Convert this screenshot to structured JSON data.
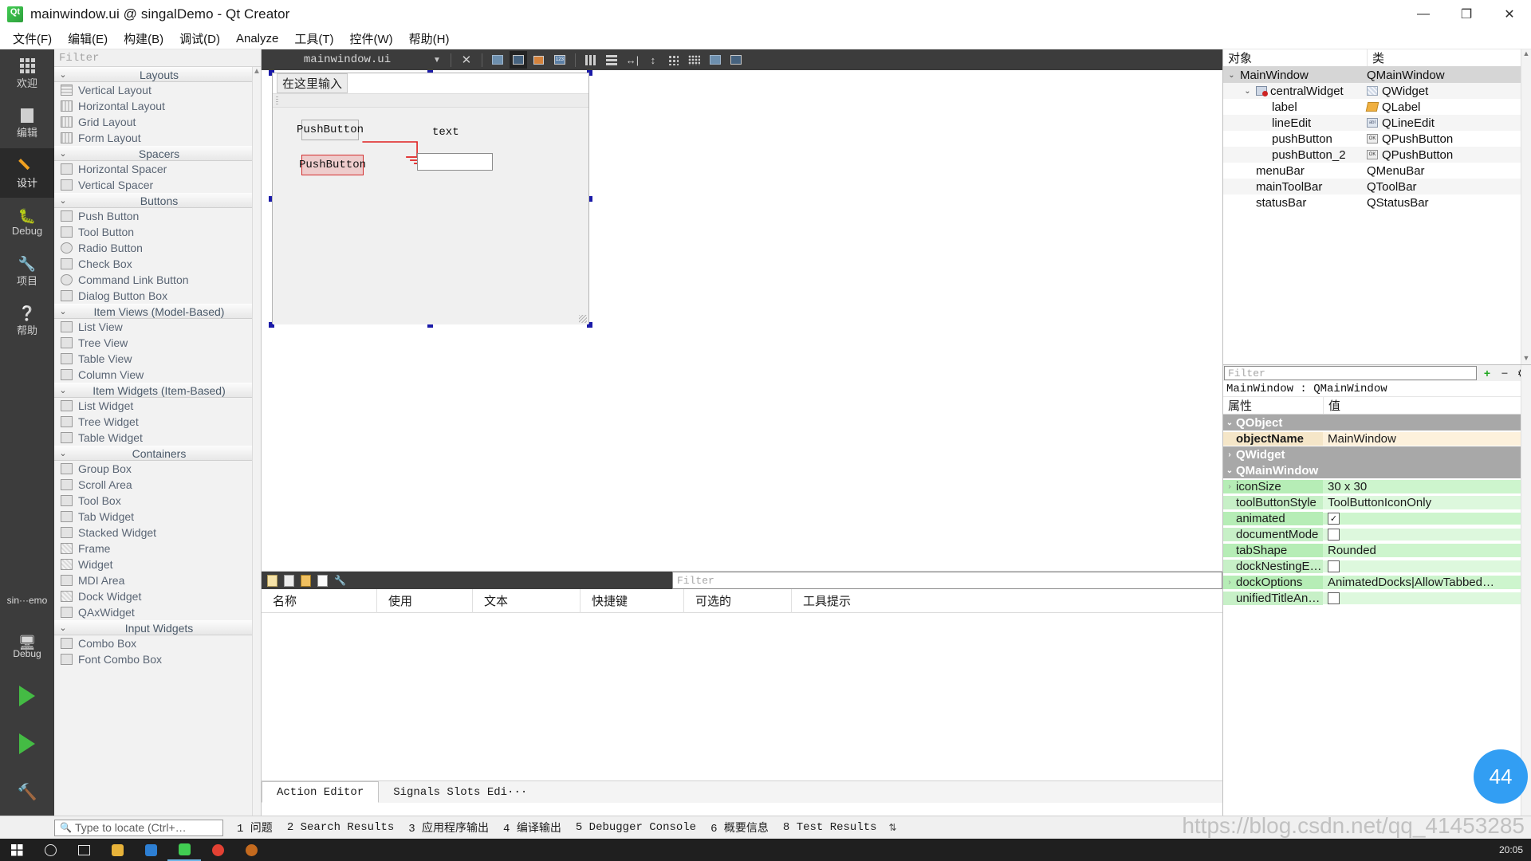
{
  "window": {
    "title": "mainwindow.ui @ singalDemo - Qt Creator",
    "app_icon": "qt-logo-icon",
    "minimize": "—",
    "maximize": "❐",
    "close": "✕"
  },
  "menubar": {
    "items": [
      {
        "label": "文件(F)",
        "name": "menu-file"
      },
      {
        "label": "编辑(E)",
        "name": "menu-edit"
      },
      {
        "label": "构建(B)",
        "name": "menu-build"
      },
      {
        "label": "调试(D)",
        "name": "menu-debug"
      },
      {
        "label": "Analyze",
        "name": "menu-analyze"
      },
      {
        "label": "工具(T)",
        "name": "menu-tools"
      },
      {
        "label": "控件(W)",
        "name": "menu-window"
      },
      {
        "label": "帮助(H)",
        "name": "menu-help"
      }
    ]
  },
  "modebar": {
    "items": [
      {
        "label": "欢迎",
        "icon": "grid-icon",
        "active": false
      },
      {
        "label": "编辑",
        "icon": "document-icon",
        "active": false
      },
      {
        "label": "设计",
        "icon": "pencil-icon",
        "active": true
      },
      {
        "label": "Debug",
        "icon": "bug-icon",
        "active": false
      },
      {
        "label": "项目",
        "icon": "wrench-icon",
        "active": false
      },
      {
        "label": "帮助",
        "icon": "question-icon",
        "active": false
      }
    ],
    "kit_name": "sin···emo",
    "kit_mode": "Debug",
    "run_icon": "run-play-icon",
    "debug_icon": "debug-play-icon",
    "build_icon": "build-hammer-icon"
  },
  "widgetbox": {
    "filter_placeholder": "Filter",
    "groups": [
      {
        "name": "Layouts",
        "items": [
          {
            "label": "Vertical Layout",
            "icon": "vertical-layout-icon"
          },
          {
            "label": "Horizontal Layout",
            "icon": "horizontal-layout-icon"
          },
          {
            "label": "Grid Layout",
            "icon": "grid-layout-icon"
          },
          {
            "label": "Form Layout",
            "icon": "form-layout-icon"
          }
        ]
      },
      {
        "name": "Spacers",
        "items": [
          {
            "label": "Horizontal Spacer",
            "icon": "horizontal-spacer-icon"
          },
          {
            "label": "Vertical Spacer",
            "icon": "vertical-spacer-icon"
          }
        ]
      },
      {
        "name": "Buttons",
        "items": [
          {
            "label": "Push Button",
            "icon": "push-button-icon"
          },
          {
            "label": "Tool Button",
            "icon": "tool-button-icon"
          },
          {
            "label": "Radio Button",
            "icon": "radio-button-icon"
          },
          {
            "label": "Check Box",
            "icon": "check-box-icon"
          },
          {
            "label": "Command Link Button",
            "icon": "command-link-icon"
          },
          {
            "label": "Dialog Button Box",
            "icon": "dialog-button-box-icon"
          }
        ]
      },
      {
        "name": "Item Views (Model-Based)",
        "items": [
          {
            "label": "List View",
            "icon": "list-view-icon"
          },
          {
            "label": "Tree View",
            "icon": "tree-view-icon"
          },
          {
            "label": "Table View",
            "icon": "table-view-icon"
          },
          {
            "label": "Column View",
            "icon": "column-view-icon"
          }
        ]
      },
      {
        "name": "Item Widgets (Item-Based)",
        "items": [
          {
            "label": "List Widget",
            "icon": "list-widget-icon"
          },
          {
            "label": "Tree Widget",
            "icon": "tree-widget-icon"
          },
          {
            "label": "Table Widget",
            "icon": "table-widget-icon"
          }
        ]
      },
      {
        "name": "Containers",
        "items": [
          {
            "label": "Group Box",
            "icon": "group-box-icon"
          },
          {
            "label": "Scroll Area",
            "icon": "scroll-area-icon"
          },
          {
            "label": "Tool Box",
            "icon": "tool-box-icon"
          },
          {
            "label": "Tab Widget",
            "icon": "tab-widget-icon"
          },
          {
            "label": "Stacked Widget",
            "icon": "stacked-widget-icon"
          },
          {
            "label": "Frame",
            "icon": "frame-icon"
          },
          {
            "label": "Widget",
            "icon": "widget-icon"
          },
          {
            "label": "MDI Area",
            "icon": "mdi-area-icon"
          },
          {
            "label": "Dock Widget",
            "icon": "dock-widget-icon"
          },
          {
            "label": "QAxWidget",
            "icon": "qax-widget-icon"
          }
        ]
      },
      {
        "name": "Input Widgets",
        "items": [
          {
            "label": "Combo Box",
            "icon": "combo-box-icon"
          },
          {
            "label": "Font Combo Box",
            "icon": "font-combo-box-icon"
          }
        ]
      }
    ]
  },
  "editor_toolbar": {
    "filename": "mainwindow.ui",
    "close_label": "✕",
    "buttons": [
      {
        "name": "edit-widgets-icon"
      },
      {
        "name": "edit-signals-slots-icon",
        "active": true
      },
      {
        "name": "edit-buddies-icon"
      },
      {
        "name": "edit-tab-order-icon"
      },
      {
        "name": "layout-horizontally-icon"
      },
      {
        "name": "layout-vertically-icon"
      },
      {
        "name": "layout-splitter-horizontal-icon"
      },
      {
        "name": "layout-splitter-vertical-icon"
      },
      {
        "name": "layout-form-icon"
      },
      {
        "name": "layout-grid-icon"
      },
      {
        "name": "break-layout-icon"
      },
      {
        "name": "adjust-size-icon"
      }
    ]
  },
  "form": {
    "menubar_placeholder": "在这里输入",
    "widgets": [
      {
        "name": "pushButton",
        "type": "QPushButton",
        "text": "PushButton",
        "selected": false
      },
      {
        "name": "pushButton_2",
        "type": "QPushButton",
        "text": "PushButton",
        "selected": true
      },
      {
        "name": "label",
        "type": "QLabel",
        "text": "text"
      },
      {
        "name": "lineEdit",
        "type": "QLineEdit",
        "text": ""
      }
    ],
    "connection_color": "#e02020"
  },
  "object_inspector": {
    "header": {
      "object": "对象",
      "class": "类"
    },
    "rows": [
      {
        "object": "MainWindow",
        "class": "QMainWindow",
        "indent": 0,
        "chevron": "⌄",
        "icon": "",
        "selected": true
      },
      {
        "object": "centralWidget",
        "class": "QWidget",
        "indent": 1,
        "chevron": "⌄",
        "icon": "central-widget-icon",
        "class_icon": "widget-hatch-icon",
        "selected": false
      },
      {
        "object": "label",
        "class": "QLabel",
        "indent": 2,
        "chevron": "",
        "class_icon": "label-tag-icon",
        "selected": false
      },
      {
        "object": "lineEdit",
        "class": "QLineEdit",
        "indent": 2,
        "chevron": "",
        "class_icon": "lineedit-abi-icon",
        "selected": false
      },
      {
        "object": "pushButton",
        "class": "QPushButton",
        "indent": 2,
        "chevron": "",
        "class_icon": "pushbutton-ok-icon",
        "selected": false
      },
      {
        "object": "pushButton_2",
        "class": "QPushButton",
        "indent": 2,
        "chevron": "",
        "class_icon": "pushbutton-ok-icon",
        "selected": false
      },
      {
        "object": "menuBar",
        "class": "QMenuBar",
        "indent": 1,
        "chevron": "",
        "class_icon": "",
        "selected": false
      },
      {
        "object": "mainToolBar",
        "class": "QToolBar",
        "indent": 1,
        "chevron": "",
        "class_icon": "",
        "selected": false
      },
      {
        "object": "statusBar",
        "class": "QStatusBar",
        "indent": 1,
        "chevron": "",
        "class_icon": "",
        "selected": false
      }
    ]
  },
  "property_editor": {
    "filter_placeholder": "Filter",
    "object_line": "MainWindow : QMainWindow",
    "header": {
      "property": "属性",
      "value": "值"
    },
    "add_label": "+",
    "remove_label": "−",
    "config_label": "⚙",
    "rows": [
      {
        "kind": "group",
        "key": "QObject",
        "value": "",
        "chevron": "⌄"
      },
      {
        "kind": "tan",
        "key": "objectName",
        "value": "MainWindow",
        "chevron": ""
      },
      {
        "kind": "group",
        "key": "QWidget",
        "value": "",
        "chevron": "›"
      },
      {
        "kind": "group",
        "key": "QMainWindow",
        "value": "",
        "chevron": "⌄"
      },
      {
        "kind": "green",
        "key": "iconSize",
        "value": "30 x 30",
        "chevron": "›"
      },
      {
        "kind": "green2",
        "key": "toolButtonStyle",
        "value": "ToolButtonIconOnly",
        "chevron": ""
      },
      {
        "kind": "green",
        "key": "animated",
        "value": "",
        "checkbox": true,
        "checked": true,
        "chevron": ""
      },
      {
        "kind": "green2",
        "key": "documentMode",
        "value": "",
        "checkbox": true,
        "checked": false,
        "chevron": ""
      },
      {
        "kind": "green",
        "key": "tabShape",
        "value": "Rounded",
        "chevron": ""
      },
      {
        "kind": "green2",
        "key": "dockNestingE…",
        "value": "",
        "checkbox": true,
        "checked": false,
        "chevron": ""
      },
      {
        "kind": "green",
        "key": "dockOptions",
        "value": "AnimatedDocks|AllowTabbed…",
        "chevron": "›"
      },
      {
        "kind": "green2",
        "key": "unifiedTitleAn…",
        "value": "",
        "checkbox": true,
        "checked": false,
        "chevron": ""
      }
    ]
  },
  "action_editor": {
    "filter_placeholder": "Filter",
    "toolbar_icons": [
      "new-action-icon",
      "copy-action-icon",
      "edit-action-icon",
      "delete-action-icon",
      "configure-icon"
    ],
    "columns": [
      "名称",
      "使用",
      "文本",
      "快捷键",
      "可选的",
      "工具提示"
    ],
    "rows": [],
    "tabs": [
      {
        "label": "Action Editor",
        "active": true
      },
      {
        "label": "Signals  Slots Edi···",
        "active": false
      }
    ]
  },
  "statusbar": {
    "locator_placeholder": "Type to locate (Ctrl+…",
    "search_icon": "magnifier-icon",
    "output_tabs": [
      "1 问题",
      "2 Search Results",
      "3 应用程序输出",
      "4 编译输出",
      "5 Debugger Console",
      "6 概要信息",
      "8 Test Results"
    ],
    "updown": "⇅"
  },
  "taskbar": {
    "icons": [
      "windows-start-icon",
      "search-circle-icon",
      "task-view-icon",
      "folder-icon",
      "vscode-icon",
      "qtcreator-icon",
      "chrome-icon",
      "app-icon"
    ],
    "tray_time": "20:05"
  },
  "watermark": {
    "url": "https://blog.csdn.net/qq_41453285",
    "badge": "44"
  },
  "colors": {
    "accent_selection": "#1a1aa8",
    "connection_red": "#e02020",
    "property_green": "#b6edb6",
    "property_tan": "#f5e6c8",
    "dark_chrome": "#3c3c3c"
  }
}
